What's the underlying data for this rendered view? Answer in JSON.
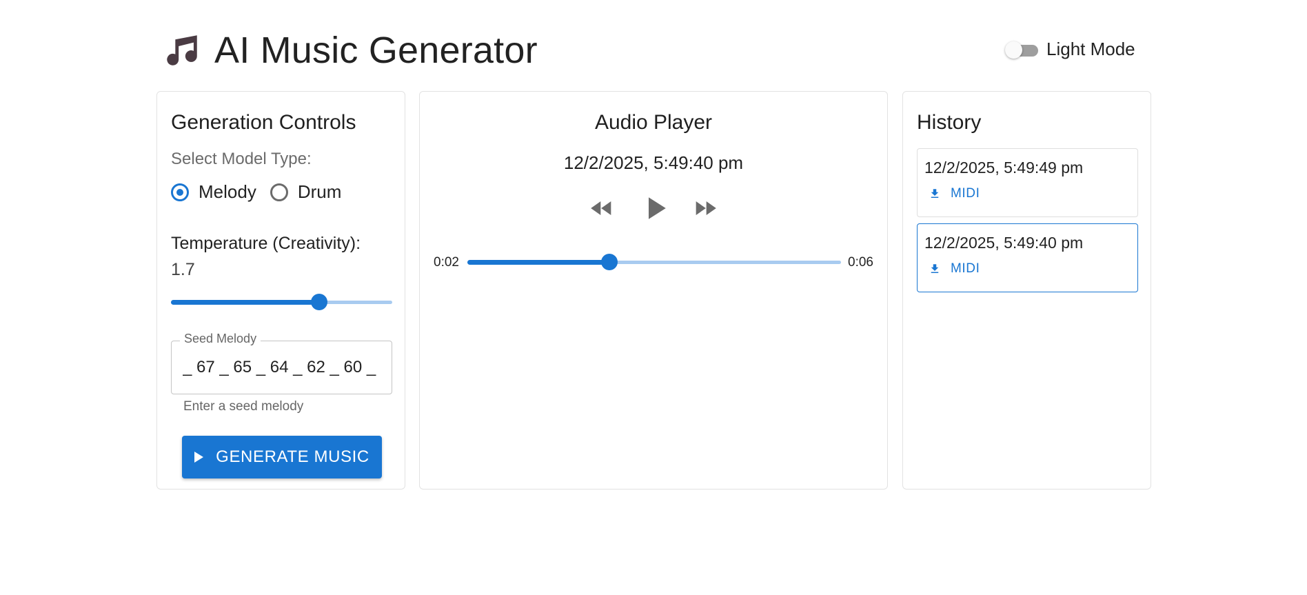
{
  "header": {
    "title": "AI Music Generator",
    "logo_icon": "music-note-icon",
    "theme_label": "Light Mode",
    "theme_dark_enabled": false
  },
  "colors": {
    "primary": "#1976d2",
    "primary_light": "#a8cbf0",
    "logo": "#4a3b43",
    "icon_gray": "#6b6b6b"
  },
  "controls_panel": {
    "title": "Generation Controls",
    "model_label": "Select Model Type:",
    "model_options": [
      {
        "label": "Melody",
        "selected": true
      },
      {
        "label": "Drum",
        "selected": false
      }
    ],
    "temperature_label": "Temperature (Creativity):",
    "temperature_value": "1.7",
    "temperature_fraction": 0.67,
    "seed_label": "Seed Melody",
    "seed_value": "_ 67 _ 65 _ 64 _ 62 _ 60 _",
    "seed_helper": "Enter a seed melody",
    "generate_label": "GENERATE MUSIC",
    "generate_icon": "play-icon"
  },
  "player": {
    "title": "Audio Player",
    "track_timestamp": "12/2/2025, 5:49:40 pm",
    "current_time": "0:02",
    "duration": "0:06",
    "progress_fraction": 0.38,
    "icons": [
      "rewind-icon",
      "play-icon",
      "fast-forward-icon"
    ]
  },
  "history": {
    "title": "History",
    "items": [
      {
        "timestamp": "12/2/2025, 5:49:49 pm",
        "link_label": "MIDI",
        "selected": false
      },
      {
        "timestamp": "12/2/2025, 5:49:40 pm",
        "link_label": "MIDI",
        "selected": true
      }
    ],
    "link_icon": "download-icon"
  }
}
